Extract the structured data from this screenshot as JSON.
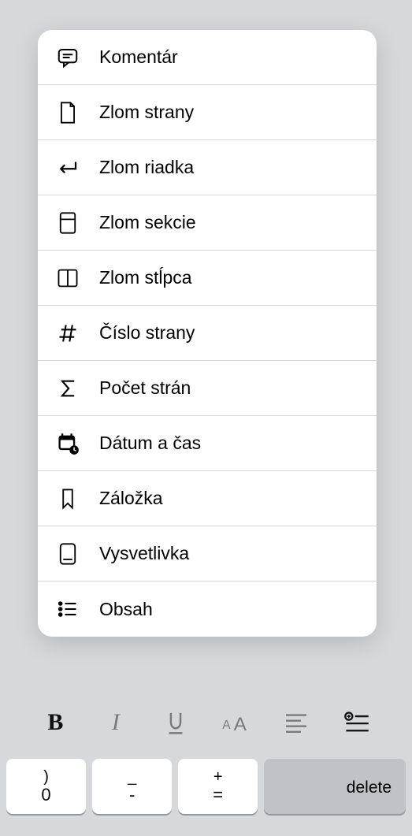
{
  "menu": {
    "items": [
      {
        "label": "Komentár",
        "icon": "comment"
      },
      {
        "label": "Zlom strany",
        "icon": "page-break"
      },
      {
        "label": "Zlom riadka",
        "icon": "line-break"
      },
      {
        "label": "Zlom sekcie",
        "icon": "section-break"
      },
      {
        "label": "Zlom stĺpca",
        "icon": "column-break"
      },
      {
        "label": "Číslo strany",
        "icon": "hash"
      },
      {
        "label": "Počet strán",
        "icon": "sigma"
      },
      {
        "label": "Dátum a čas",
        "icon": "calendar"
      },
      {
        "label": "Záložka",
        "icon": "bookmark"
      },
      {
        "label": "Vysvetlivka",
        "icon": "footnote"
      },
      {
        "label": "Obsah",
        "icon": "toc"
      }
    ]
  },
  "toolbar": {
    "bold": "B",
    "italic": "I",
    "underline": "U"
  },
  "keyboard": {
    "key0_top": ")",
    "key0_bot": "0",
    "key1_top": "_",
    "key1_bot": "-",
    "key2_top": "+",
    "key2_bot": "=",
    "delete": "delete"
  }
}
